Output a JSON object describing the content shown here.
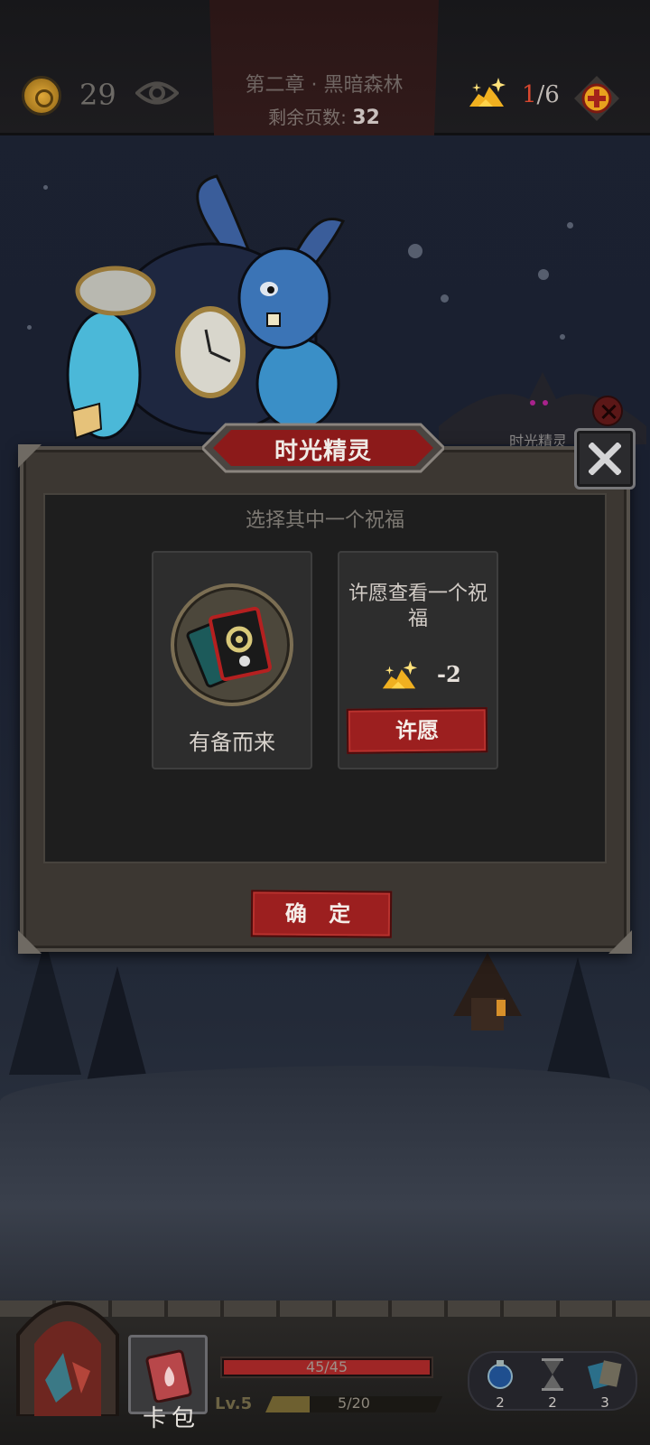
{
  "hud": {
    "coins": "29",
    "chapter": "第二章 · 黑暗森林",
    "pages_label": "剩余页数:",
    "pages_value": "32",
    "wish_current": "1",
    "wish_total": "/6"
  },
  "enemy": {
    "name": "时光精灵"
  },
  "dialog": {
    "title": "时光精灵",
    "prompt": "选择其中一个祝福",
    "blessing_name": "有备而来",
    "wish_text": "许愿查看一个祝福",
    "wish_cost": "-2",
    "wish_button": "许愿",
    "confirm_button": "确 定"
  },
  "player": {
    "deck_label": "卡包",
    "hp_text": "45/45",
    "hp_current": 45,
    "hp_max": 45,
    "level": "Lv.5",
    "xp_text": "5/20",
    "xp_current": 5,
    "xp_max": 20,
    "items": [
      {
        "icon": "potion-icon",
        "count": "2"
      },
      {
        "icon": "hourglass-icon",
        "count": "2"
      },
      {
        "icon": "cards-icon",
        "count": "3"
      }
    ]
  },
  "colors": {
    "accent_red": "#9c1f1f",
    "gold": "#f0b020",
    "panel": "#3c3732"
  }
}
